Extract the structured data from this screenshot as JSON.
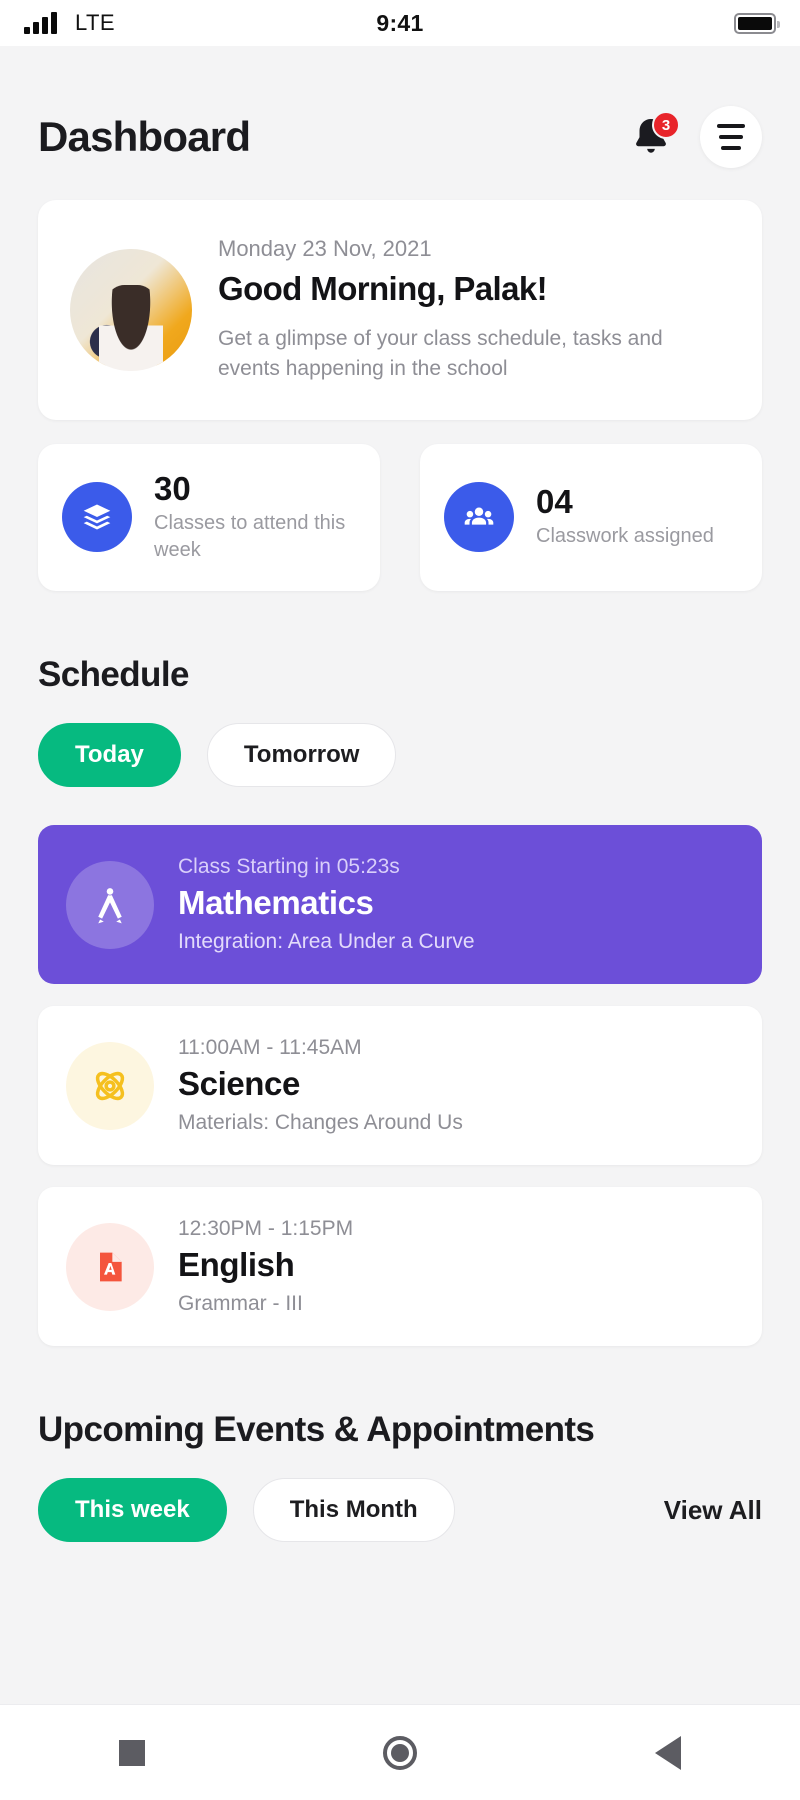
{
  "status_bar": {
    "carrier": "LTE",
    "time": "9:41",
    "signal_icon": "signal-bars-icon",
    "battery_icon": "battery-icon"
  },
  "header": {
    "title": "Dashboard",
    "notification_icon": "bell-icon",
    "notification_count": "3",
    "menu_icon": "hamburger-menu-icon"
  },
  "greeting": {
    "avatar_icon": "student-avatar",
    "date": "Monday 23 Nov, 2021",
    "title": "Good Morning, Palak!",
    "subtitle": "Get a glimpse of your class schedule, tasks and events happening in the school"
  },
  "stats": [
    {
      "icon": "layers-stack-icon",
      "value": "30",
      "label": "Classes to attend this week",
      "accent": "#3b5bea"
    },
    {
      "icon": "people-group-icon",
      "value": "04",
      "label": "Classwork assigned",
      "accent": "#3b5bea"
    }
  ],
  "schedule": {
    "section_title": "Schedule",
    "tabs": [
      {
        "label": "Today",
        "active": true
      },
      {
        "label": "Tomorrow",
        "active": false
      }
    ],
    "items": [
      {
        "icon": "compass-drafting-icon",
        "time": "Class Starting in 05:23s",
        "name": "Mathematics",
        "topic": "Integration: Area Under a Curve",
        "highlight": true,
        "color": "#6c4fd8"
      },
      {
        "icon": "atom-icon",
        "time": "11:00AM - 11:45AM",
        "name": "Science",
        "topic": "Materials: Changes Around Us",
        "highlight": false,
        "color": "#f5c01f"
      },
      {
        "icon": "document-letter-a-icon",
        "time": "12:30PM - 1:15PM",
        "name": "English",
        "topic": "Grammar - III",
        "highlight": false,
        "color": "#f4553d"
      }
    ]
  },
  "events": {
    "section_title": "Upcoming Events & Appointments",
    "tabs": [
      {
        "label": "This week",
        "active": true
      },
      {
        "label": "This Month",
        "active": false
      }
    ],
    "view_all_label": "View All"
  },
  "nav_bar": {
    "recents_icon": "square-recents-icon",
    "home_icon": "circle-home-icon",
    "back_icon": "triangle-back-icon"
  }
}
